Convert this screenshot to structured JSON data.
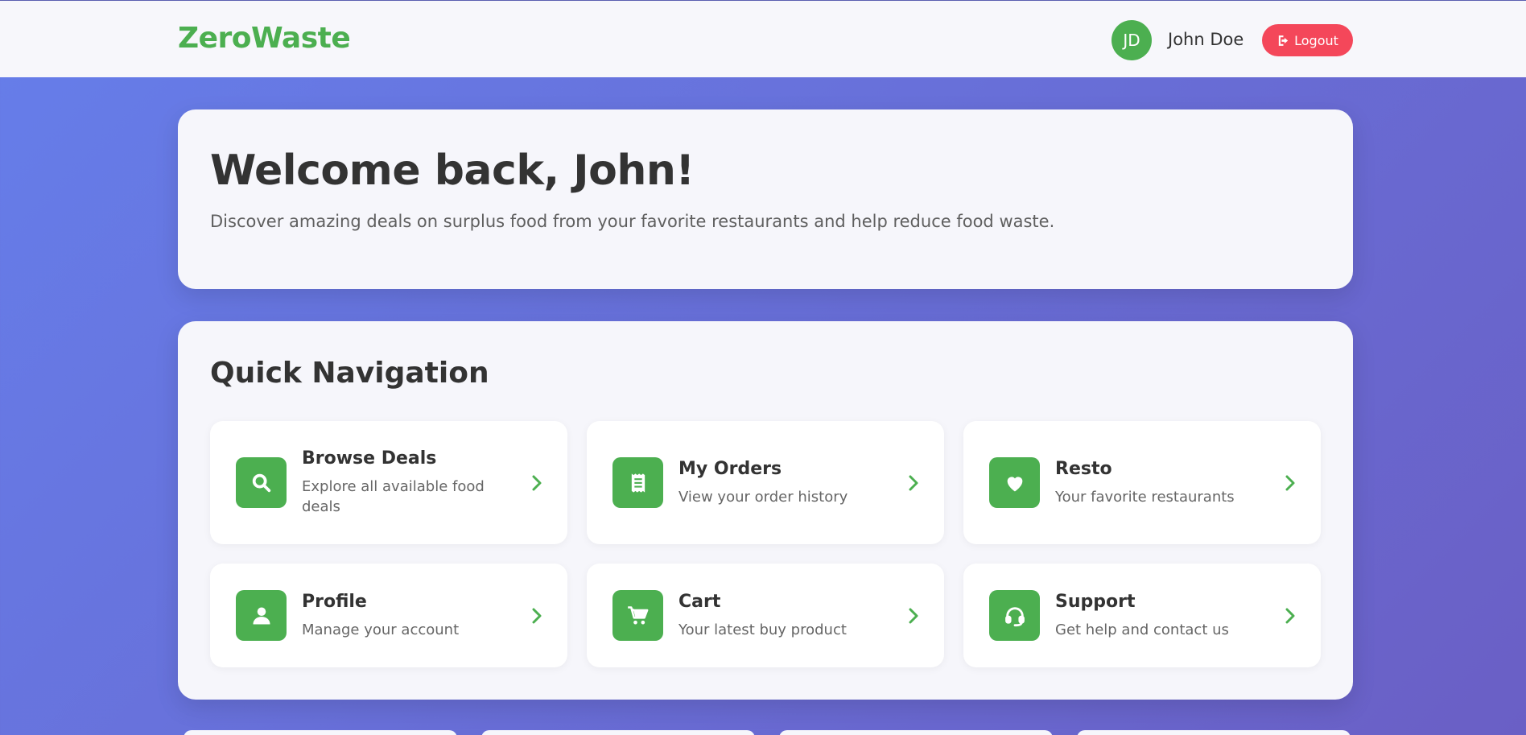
{
  "header": {
    "brand": "ZeroWaste",
    "avatar_initials": "JD",
    "user_name": "John Doe",
    "logout_label": "Logout"
  },
  "welcome": {
    "title": "Welcome back, John!",
    "subtitle": "Discover amazing deals on surplus food from your favorite restaurants and help reduce food waste."
  },
  "quick_nav": {
    "title": "Quick Navigation",
    "items": [
      {
        "title": "Browse Deals",
        "description": "Explore all available food deals",
        "icon": "search-icon"
      },
      {
        "title": "My Orders",
        "description": "View your order history",
        "icon": "receipt-icon"
      },
      {
        "title": "Resto",
        "description": "Your favorite restaurants",
        "icon": "heart-icon"
      },
      {
        "title": "Profile",
        "description": "Manage your account",
        "icon": "user-icon"
      },
      {
        "title": "Cart",
        "description": "Your latest buy product",
        "icon": "cart-icon"
      },
      {
        "title": "Support",
        "description": "Get help and contact us",
        "icon": "headset-icon"
      }
    ]
  },
  "colors": {
    "brand": "#4caf50",
    "logout": "#f4475a",
    "background_start": "#667eea",
    "background_end": "#6a5fc5"
  }
}
